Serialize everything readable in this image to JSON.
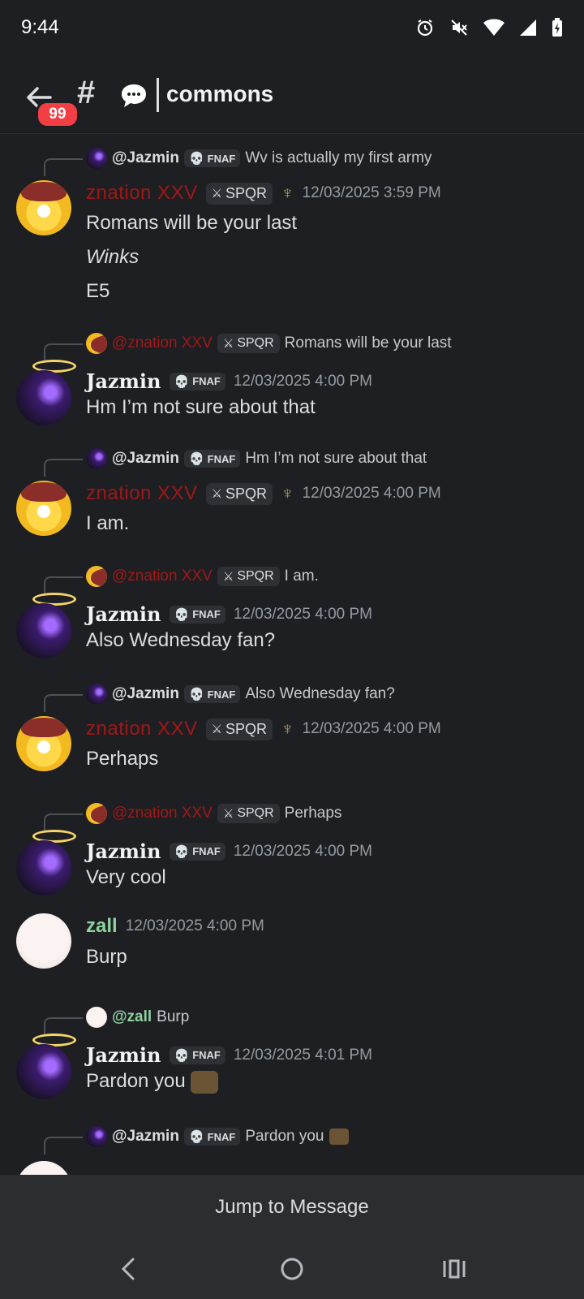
{
  "status_bar": {
    "time": "9:44",
    "icons": [
      "alarm-icon",
      "mute-icon",
      "wifi-icon",
      "signal-icon",
      "battery-icon"
    ]
  },
  "header": {
    "badge": "99",
    "channel": "commons"
  },
  "tags": {
    "fnaf": "FNAF",
    "spqr": "SPQR"
  },
  "messages": [
    {
      "reply_to": "@Jazmin",
      "reply_text": "Wv is actually my first army",
      "author": "znation XXV",
      "time": "12/03/2025 3:59 PM",
      "lines": [
        "Romans will be your last",
        "Winks",
        "E5"
      ]
    },
    {
      "reply_to": "@znation XXV",
      "reply_text": "Romans will be your last",
      "author": "Jazmin",
      "time": "12/03/2025 4:00 PM",
      "lines": [
        "Hm I’m not sure about that"
      ]
    },
    {
      "reply_to": "@Jazmin",
      "reply_text": "Hm I’m not sure about that",
      "author": "znation XXV",
      "time": "12/03/2025 4:00 PM",
      "lines": [
        "I am."
      ]
    },
    {
      "reply_to": "@znation XXV",
      "reply_text": "I am.",
      "author": "Jazmin",
      "time": "12/03/2025 4:00 PM",
      "lines": [
        "Also Wednesday fan?"
      ]
    },
    {
      "reply_to": "@Jazmin",
      "reply_text": "Also Wednesday fan?",
      "author": "znation XXV",
      "time": "12/03/2025 4:00 PM",
      "lines": [
        "Perhaps"
      ]
    },
    {
      "reply_to": "@znation XXV",
      "reply_text": "Perhaps",
      "author": "Jazmin",
      "time": "12/03/2025 4:00 PM",
      "lines": [
        "Very cool"
      ]
    },
    {
      "author": "zall",
      "time": "12/03/2025 4:00 PM",
      "lines": [
        "Burp"
      ]
    },
    {
      "reply_to": "@zall",
      "reply_text": "Burp",
      "author": "Jazmin",
      "time": "12/03/2025 4:01 PM",
      "lines": [
        "Pardon you"
      ]
    },
    {
      "reply_to": "@Jazmin",
      "reply_text": "Pardon you"
    }
  ],
  "jump_button": "Jump to Message",
  "colors": {
    "background": "#1e1f22",
    "znation": "#a01818",
    "zall": "#8fd19e",
    "badge": "#f23f43"
  }
}
